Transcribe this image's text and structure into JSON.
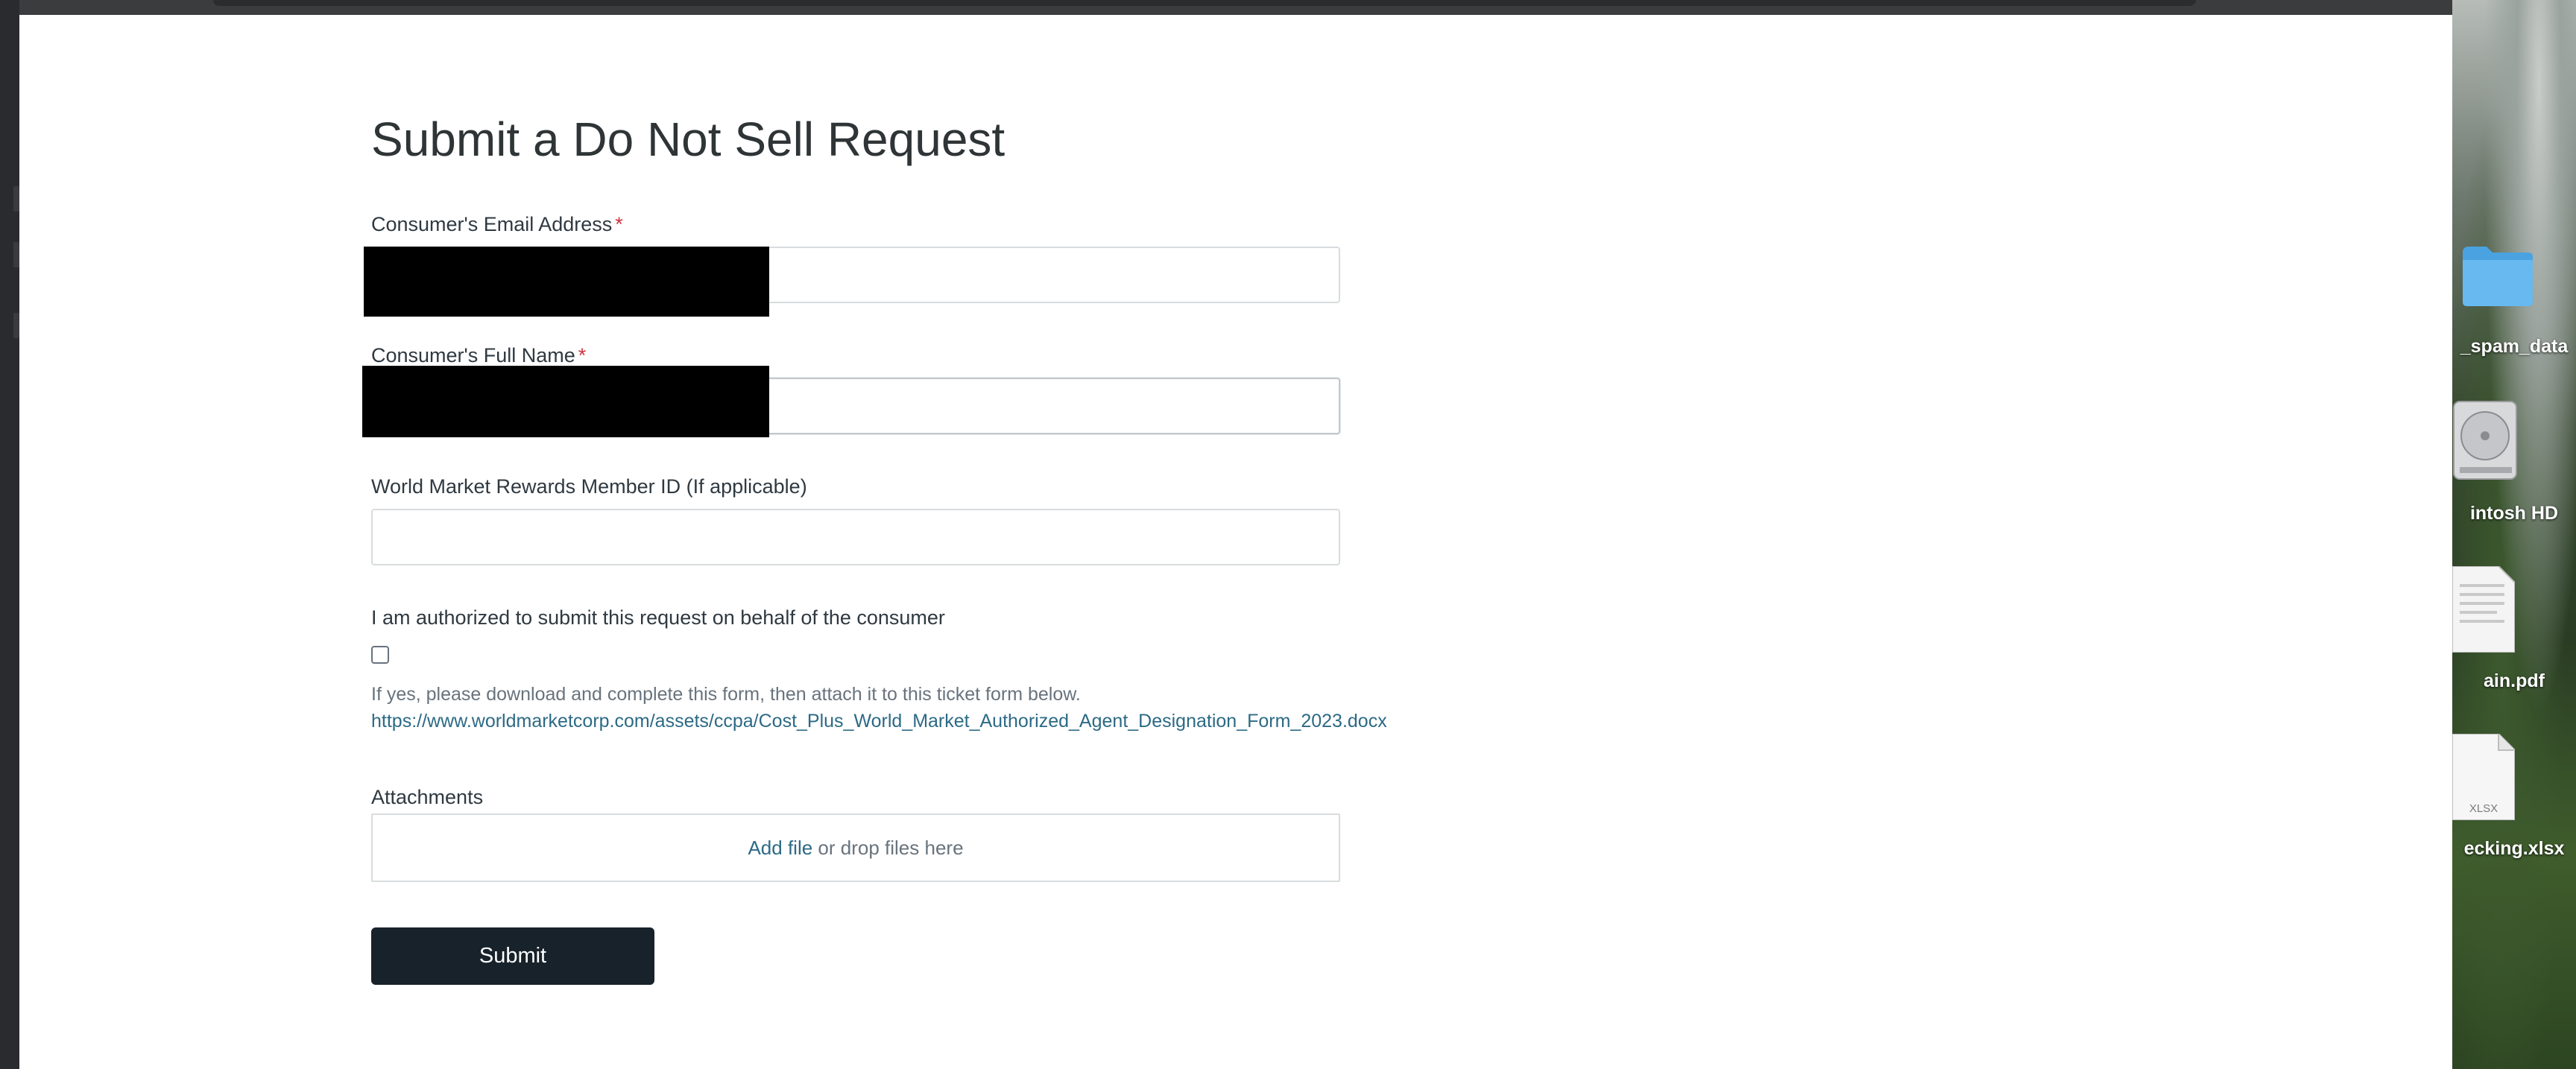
{
  "form": {
    "title": "Submit a Do Not Sell Request",
    "email_label": "Consumer's Email Address",
    "name_label": "Consumer's Full Name",
    "required_mark": "*",
    "member_id_label": "World Market Rewards Member ID (If applicable)",
    "authorized_label": "I am authorized to submit this request on behalf of the consumer",
    "authorized_checked": false,
    "hint": "If yes, please download and complete this form, then attach it to this ticket form below.",
    "form_link": "https://www.worldmarketcorp.com/assets/ccpa/Cost_Plus_World_Market_Authorized_Agent_Designation_Form_2023.docx",
    "attachments_label": "Attachments",
    "add_file": "Add file",
    "drop_text": " or drop files here",
    "submit_label": "Submit"
  },
  "desktop": {
    "items": [
      {
        "label": "_spam_data",
        "icon": "folder-icon"
      },
      {
        "label": "intosh HD",
        "icon": "hard-disk-icon"
      },
      {
        "label": "ain.pdf",
        "icon": "pdf-document-icon"
      },
      {
        "label": "ecking.xlsx",
        "icon": "xlsx-document-icon",
        "badge": "XLSX"
      }
    ]
  },
  "colors": {
    "accent_link": "#2c6a85",
    "submit_bg": "#17222a",
    "required": "#cc3340"
  }
}
